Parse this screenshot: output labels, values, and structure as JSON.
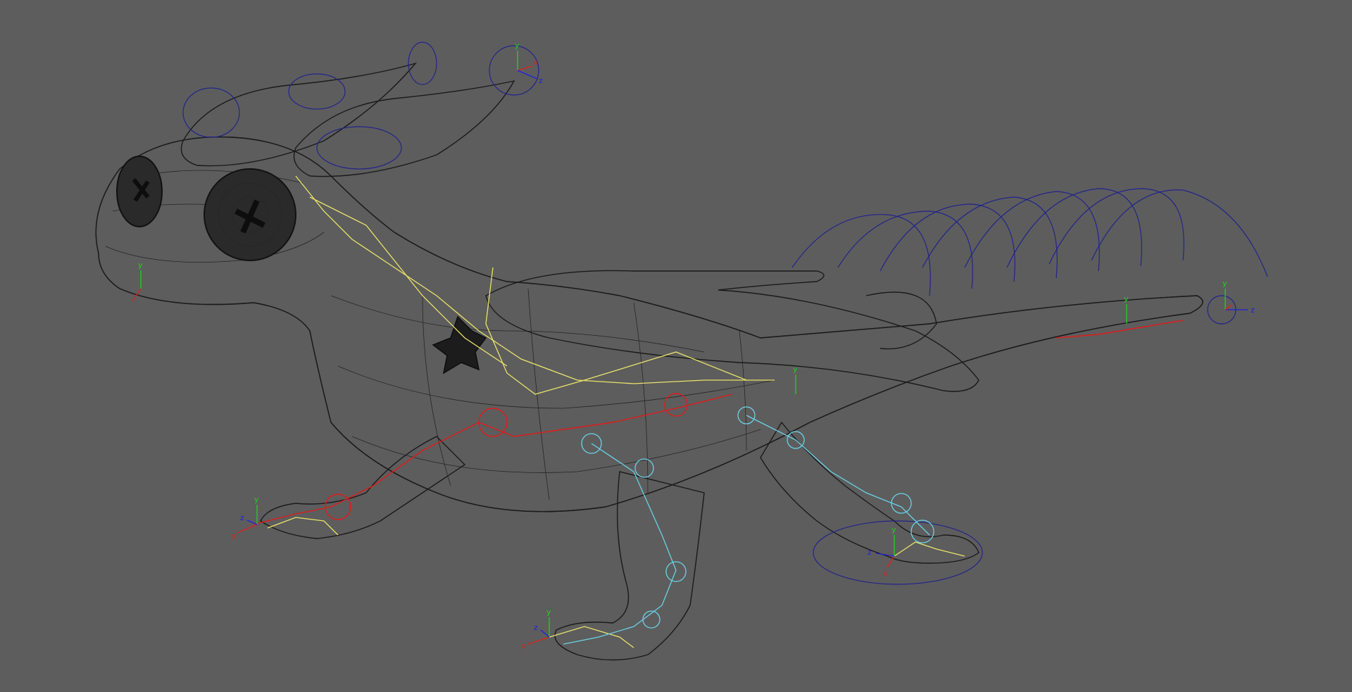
{
  "viewport": {
    "background_color": "#5d5d5d",
    "display_mode": "wireframe",
    "subject": "dragon-rig"
  },
  "colors": {
    "mesh": "#1a1a1a",
    "control_curves": "#23248a",
    "spine_joints": "#e9e36a",
    "left_limbs": "#e11b1b",
    "right_limbs": "#69d3e6",
    "axis_x": "#e02020",
    "axis_y": "#20d020",
    "axis_z": "#2020e0"
  },
  "axis_labels": {
    "x": "x",
    "y": "y",
    "z": "z"
  },
  "icons": {
    "manipulator": "xyz-axis-gizmo-icon",
    "joint": "joint-sphere-icon",
    "control": "circle-control-icon"
  }
}
